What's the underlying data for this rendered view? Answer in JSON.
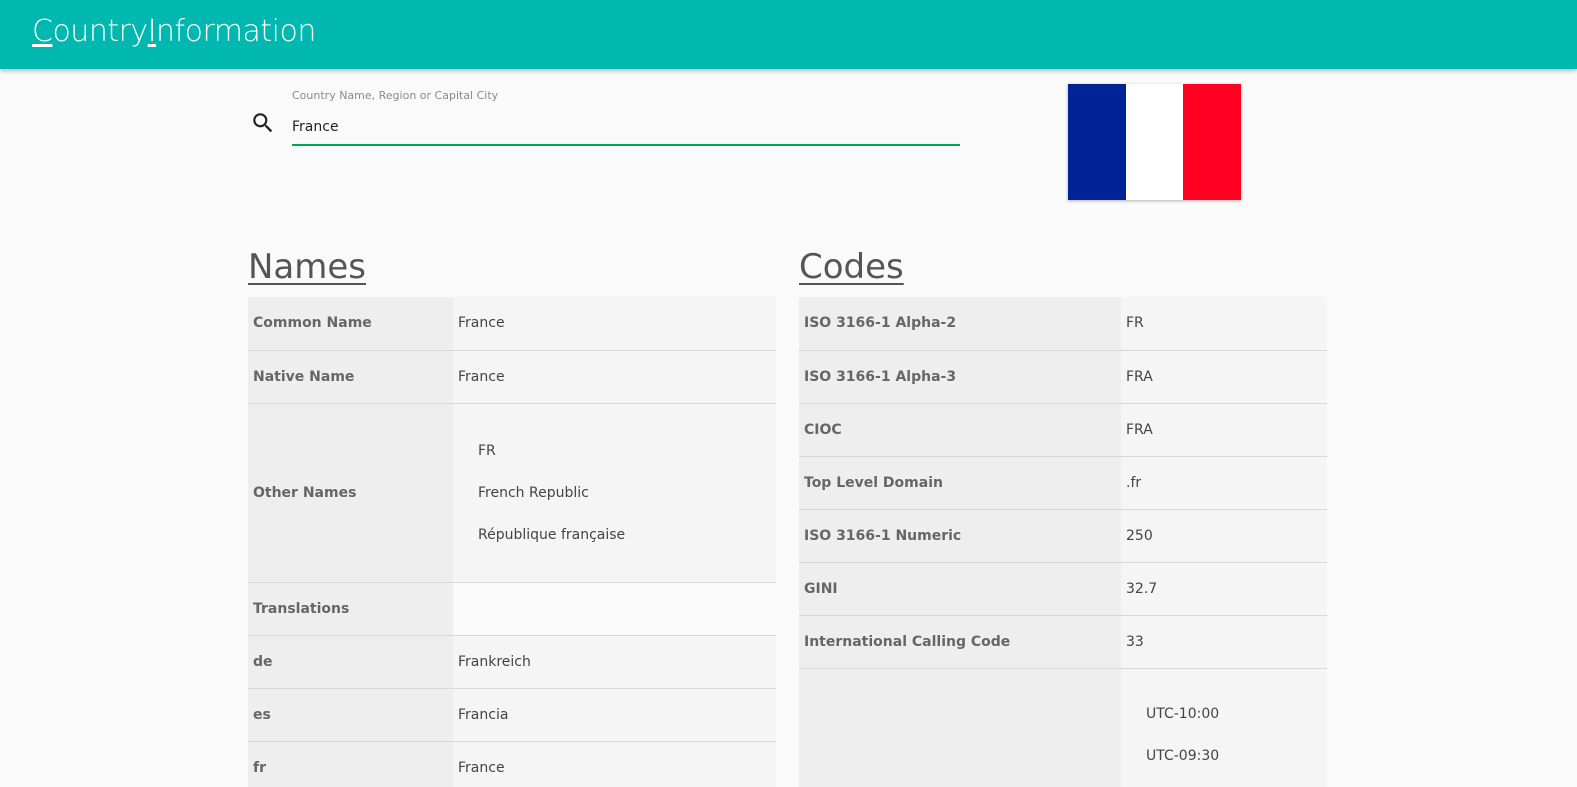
{
  "app": {
    "title_first_letter": "C",
    "title_part1": "ountry",
    "title_second_letter": "I",
    "title_part2": "nformation"
  },
  "search": {
    "label": "Country Name, Region or Capital City",
    "value": "France",
    "icon": "search-icon"
  },
  "flag": {
    "colors": [
      "#002395",
      "#ffffff",
      "#ff0020"
    ]
  },
  "names": {
    "heading": "Names",
    "common_name": {
      "key": "Common Name",
      "value": "France"
    },
    "native_name": {
      "key": "Native Name",
      "value": "France"
    },
    "other_names": {
      "key": "Other Names",
      "values": [
        "FR",
        "French Republic",
        "République française"
      ]
    },
    "translations": {
      "key": "Translations"
    },
    "translation_rows": [
      {
        "key": "de",
        "value": "Frankreich"
      },
      {
        "key": "es",
        "value": "Francia"
      },
      {
        "key": "fr",
        "value": "France"
      }
    ]
  },
  "codes": {
    "heading": "Codes",
    "rows": [
      {
        "key": "ISO 3166-1 Alpha-2",
        "value": "FR"
      },
      {
        "key": "ISO 3166-1 Alpha-3",
        "value": "FRA"
      },
      {
        "key": "CIOC",
        "value": "FRA"
      },
      {
        "key": "Top Level Domain",
        "value": ".fr"
      },
      {
        "key": "ISO 3166-1 Numeric",
        "value": "250"
      },
      {
        "key": "GINI",
        "value": "32.7"
      },
      {
        "key": "International Calling Code",
        "value": "33"
      }
    ],
    "timezones": {
      "values": [
        "UTC-10:00",
        "UTC-09:30"
      ]
    }
  }
}
